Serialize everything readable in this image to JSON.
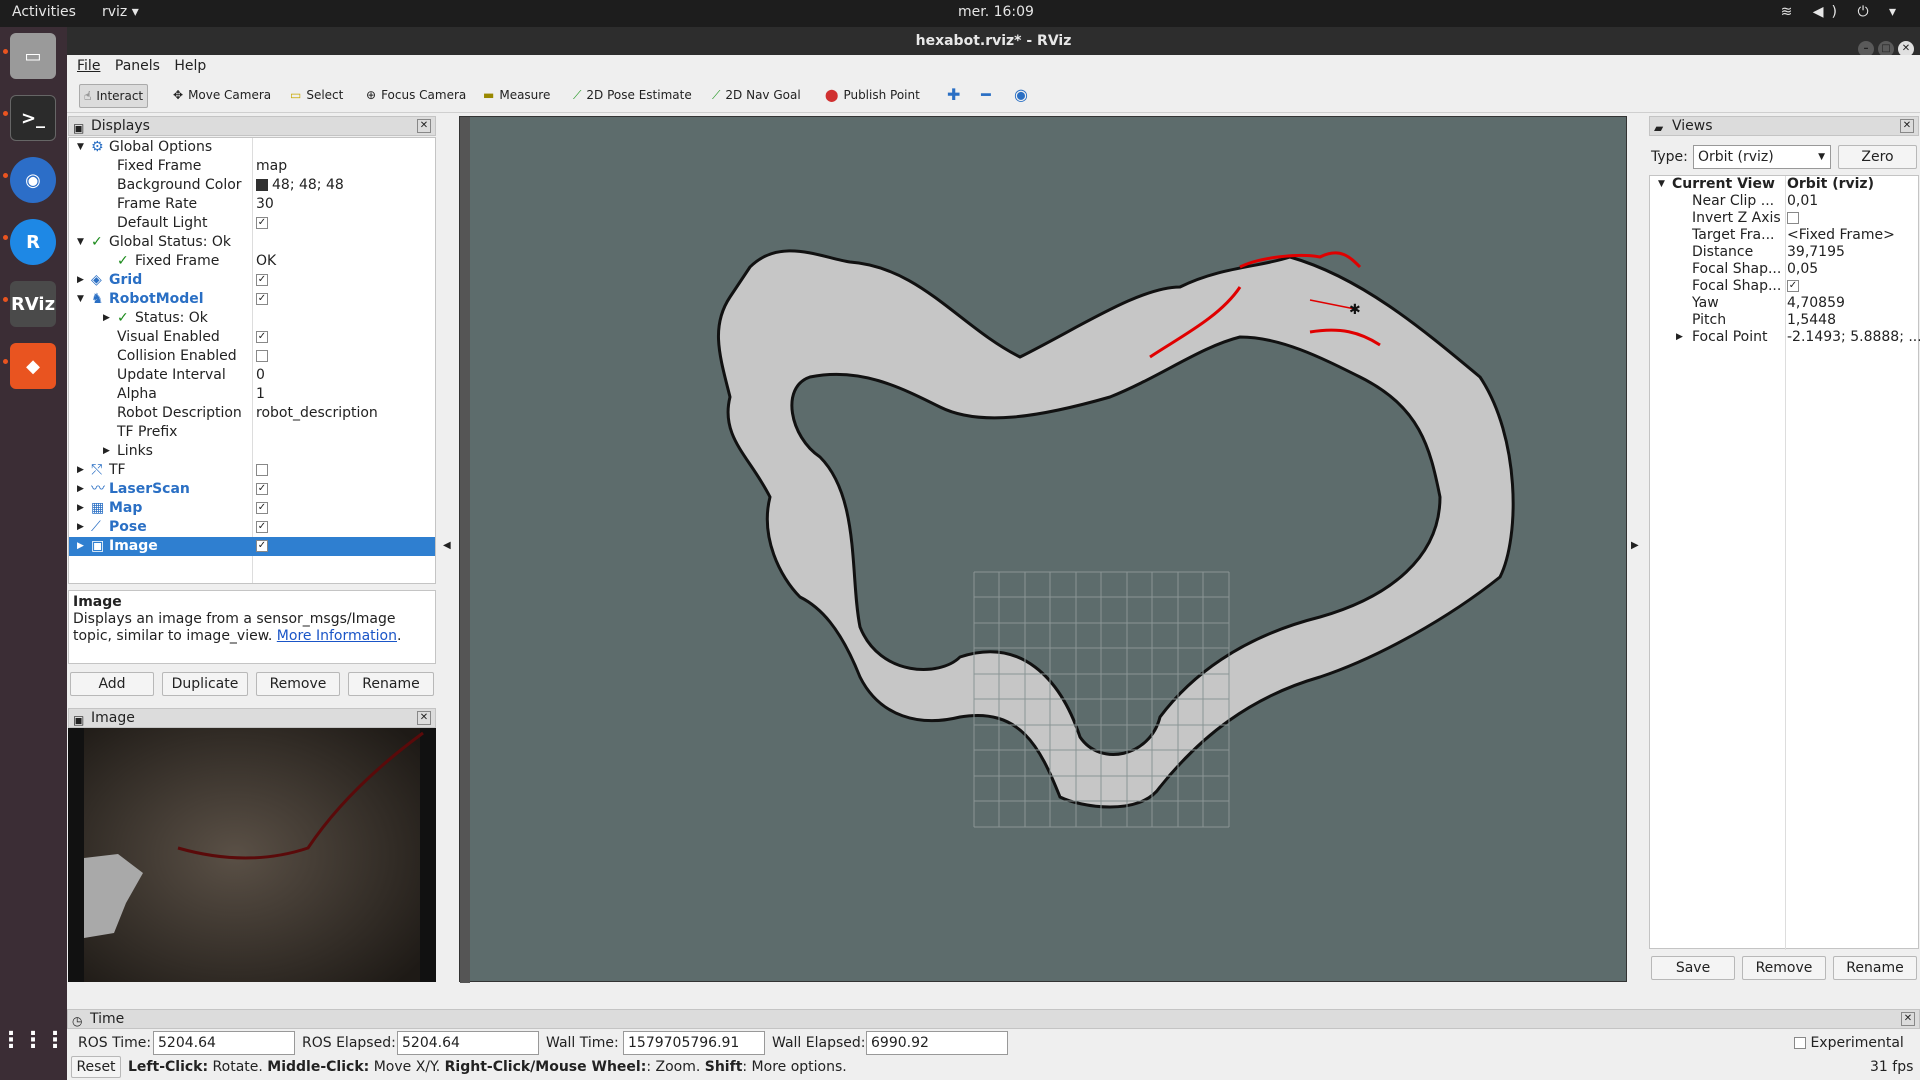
{
  "topbar": {
    "activities": "Activities",
    "app": "rviz ▾",
    "clock": "mer. 16:09",
    "tray": "≋ ◀) ⏻ ▾"
  },
  "window": {
    "title": "hexabot.rviz* - RViz"
  },
  "menu": [
    "File",
    "Panels",
    "Help"
  ],
  "toolbar": [
    {
      "label": "Interact",
      "icon": "hand-icon"
    },
    {
      "label": "Move Camera",
      "icon": "move-icon"
    },
    {
      "label": "Select",
      "icon": "select-icon"
    },
    {
      "label": "Focus Camera",
      "icon": "focus-icon"
    },
    {
      "label": "Measure",
      "icon": "ruler-icon"
    },
    {
      "label": "2D Pose Estimate",
      "icon": "arrow-green-icon"
    },
    {
      "label": "2D Nav Goal",
      "icon": "arrow-green-icon"
    },
    {
      "label": "Publish Point",
      "icon": "pin-icon"
    }
  ],
  "displays": {
    "title": "Displays",
    "rows": [
      {
        "k": "Global Options",
        "v": "",
        "lvl": 0,
        "tw": "▼",
        "icon": "⚙"
      },
      {
        "k": "Fixed Frame",
        "v": "map",
        "lvl": 1
      },
      {
        "k": "Background Color",
        "v": "48; 48; 48",
        "lvl": 1,
        "swatch": "#303030"
      },
      {
        "k": "Frame Rate",
        "v": "30",
        "lvl": 1
      },
      {
        "k": "Default Light",
        "v": "",
        "lvl": 1,
        "cb": "✓"
      },
      {
        "k": "Global Status: Ok",
        "v": "",
        "lvl": 0,
        "tw": "▼",
        "icon": "✓"
      },
      {
        "k": "Fixed Frame",
        "v": "OK",
        "lvl": 1,
        "icon": "✓"
      },
      {
        "k": "Grid",
        "v": "",
        "lvl": 0,
        "tw": "▶",
        "blue": true,
        "cb": "✓",
        "icon": "◈"
      },
      {
        "k": "RobotModel",
        "v": "",
        "lvl": 0,
        "tw": "▼",
        "blue": true,
        "cb": "✓",
        "icon": "♞"
      },
      {
        "k": "Status: Ok",
        "v": "",
        "lvl": 1,
        "tw": "▶",
        "icon": "✓"
      },
      {
        "k": "Visual Enabled",
        "v": "",
        "lvl": 1,
        "cb": "✓"
      },
      {
        "k": "Collision Enabled",
        "v": "",
        "lvl": 1,
        "cb": ""
      },
      {
        "k": "Update Interval",
        "v": "0",
        "lvl": 1
      },
      {
        "k": "Alpha",
        "v": "1",
        "lvl": 1
      },
      {
        "k": "Robot Description",
        "v": "robot_description",
        "lvl": 1
      },
      {
        "k": "TF Prefix",
        "v": "",
        "lvl": 1
      },
      {
        "k": "Links",
        "v": "",
        "lvl": 1,
        "tw": "▶"
      },
      {
        "k": "TF",
        "v": "",
        "lvl": 0,
        "tw": "▶",
        "cb": "",
        "icon": "⤲"
      },
      {
        "k": "LaserScan",
        "v": "",
        "lvl": 0,
        "tw": "▶",
        "blue": true,
        "cb": "✓",
        "icon": "〰"
      },
      {
        "k": "Map",
        "v": "",
        "lvl": 0,
        "tw": "▶",
        "blue": true,
        "cb": "✓",
        "icon": "▦"
      },
      {
        "k": "Pose",
        "v": "",
        "lvl": 0,
        "tw": "▶",
        "blue": true,
        "cb": "✓",
        "icon": "⟋"
      },
      {
        "k": "Image",
        "v": "",
        "lvl": 0,
        "tw": "▶",
        "sel": true,
        "cb": "✓",
        "icon": "▣"
      }
    ]
  },
  "desc": {
    "title": "Image",
    "text": "Displays an image from a sensor_msgs/Image topic, similar to image_view.",
    "link": "More Information",
    "tail": "."
  },
  "display_buttons": [
    "Add",
    "Duplicate",
    "Remove",
    "Rename"
  ],
  "image_panel": {
    "title": "Image"
  },
  "views": {
    "title": "Views",
    "type_label": "Type:",
    "type_value": "Orbit (rviz)",
    "zero": "Zero",
    "rows": [
      {
        "k": "Current View",
        "v": "Orbit (rviz)",
        "bold": true,
        "tw": "▼"
      },
      {
        "k": "Near Clip ...",
        "v": "0,01"
      },
      {
        "k": "Invert Z Axis",
        "v": "",
        "cb": ""
      },
      {
        "k": "Target Fra...",
        "v": "<Fixed Frame>"
      },
      {
        "k": "Distance",
        "v": "39,7195"
      },
      {
        "k": "Focal Shap...",
        "v": "0,05"
      },
      {
        "k": "Focal Shap...",
        "v": "",
        "cb": "✓"
      },
      {
        "k": "Yaw",
        "v": "4,70859"
      },
      {
        "k": "Pitch",
        "v": "1,5448"
      },
      {
        "k": "Focal Point",
        "v": "-2.1493; 5.8888; ...",
        "tw": "▶"
      }
    ],
    "buttons": [
      "Save",
      "Remove",
      "Rename"
    ]
  },
  "time": {
    "title": "Time",
    "ros_time_label": "ROS Time:",
    "ros_time": "5204.64",
    "ros_elapsed_label": "ROS Elapsed:",
    "ros_elapsed": "5204.64",
    "wall_time_label": "Wall Time:",
    "wall_time": "1579705796.91",
    "wall_elapsed_label": "Wall Elapsed:",
    "wall_elapsed": "6990.92",
    "experimental": "Experimental",
    "reset": "Reset",
    "help_parts": [
      [
        "Left-Click:",
        true
      ],
      [
        " Rotate. ",
        false
      ],
      [
        "Middle-Click:",
        true
      ],
      [
        " Move X/Y. ",
        false
      ],
      [
        "Right-Click/Mouse Wheel:",
        true
      ],
      [
        ": Zoom. ",
        false
      ],
      [
        "Shift",
        true
      ],
      [
        ": More options.",
        false
      ]
    ],
    "fps": "31 fps"
  },
  "colors": {
    "map_free": "#c4c4c4",
    "map_edge": "#111111",
    "laser": "#e00000",
    "viewport_bg": "#5d6c6c",
    "selected": "#2f7fd0"
  }
}
